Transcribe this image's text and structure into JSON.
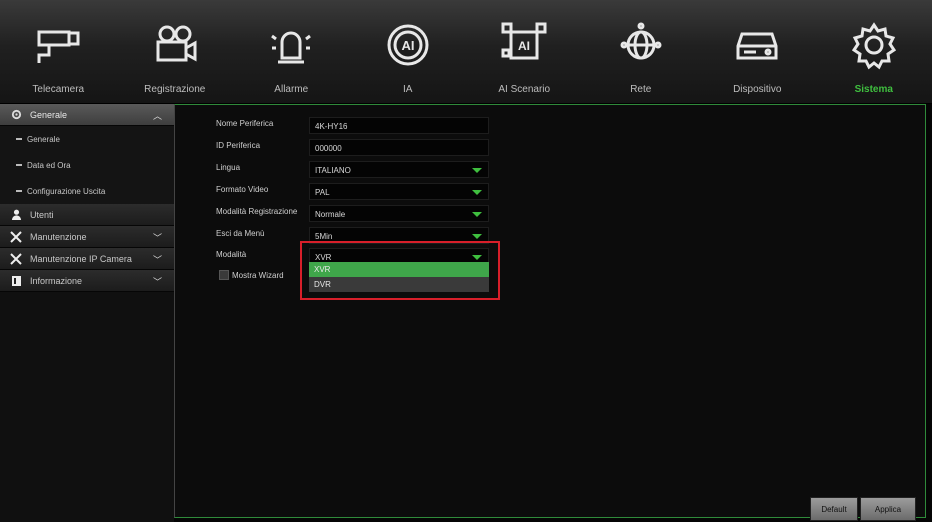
{
  "top_menu": {
    "tabs": [
      {
        "label": "Telecamera",
        "icon": "camera-icon"
      },
      {
        "label": "Registrazione",
        "icon": "video-recorder-icon"
      },
      {
        "label": "Allarme",
        "icon": "alarm-siren-icon"
      },
      {
        "label": "IA",
        "icon": "ai-icon"
      },
      {
        "label": "AI Scenario",
        "icon": "ai-scenario-icon"
      },
      {
        "label": "Rete",
        "icon": "network-globe-icon"
      },
      {
        "label": "Dispositivo",
        "icon": "hard-disk-icon"
      },
      {
        "label": "Sistema",
        "icon": "gear-icon",
        "active": true
      }
    ]
  },
  "sidebar": {
    "generale": "Generale",
    "sub_generale": "Generale",
    "sub_data_ora": "Data ed Ora",
    "sub_config_uscita": "Configurazione Uscita",
    "utenti": "Utenti",
    "manutenzione": "Manutenzione",
    "manutenzione_ip": "Manutenzione IP Camera",
    "informazione": "Informazione"
  },
  "form": {
    "nome_periferica": {
      "label": "Nome Periferica",
      "value": "4K-HY16"
    },
    "id_periferica": {
      "label": "ID Periferica",
      "value": "000000"
    },
    "lingua": {
      "label": "Lingua",
      "value": "ITALIANO"
    },
    "formato_video": {
      "label": "Formato Video",
      "value": "PAL"
    },
    "modalita_registrazione": {
      "label": "Modalità Registrazione",
      "value": "Normale"
    },
    "esci_menu": {
      "label": "Esci da Menù",
      "value": "5Min"
    },
    "modalita": {
      "label": "Modalità",
      "value": "XVR",
      "options": [
        "XVR",
        "DVR"
      ]
    },
    "mostra_wizard": {
      "label": "Mostra Wizard",
      "checked": false
    }
  },
  "buttons": {
    "default": "Default",
    "applica": "Applica"
  },
  "colors": {
    "accent_green": "#3fbf3f",
    "highlight_red": "#d81f2a"
  }
}
